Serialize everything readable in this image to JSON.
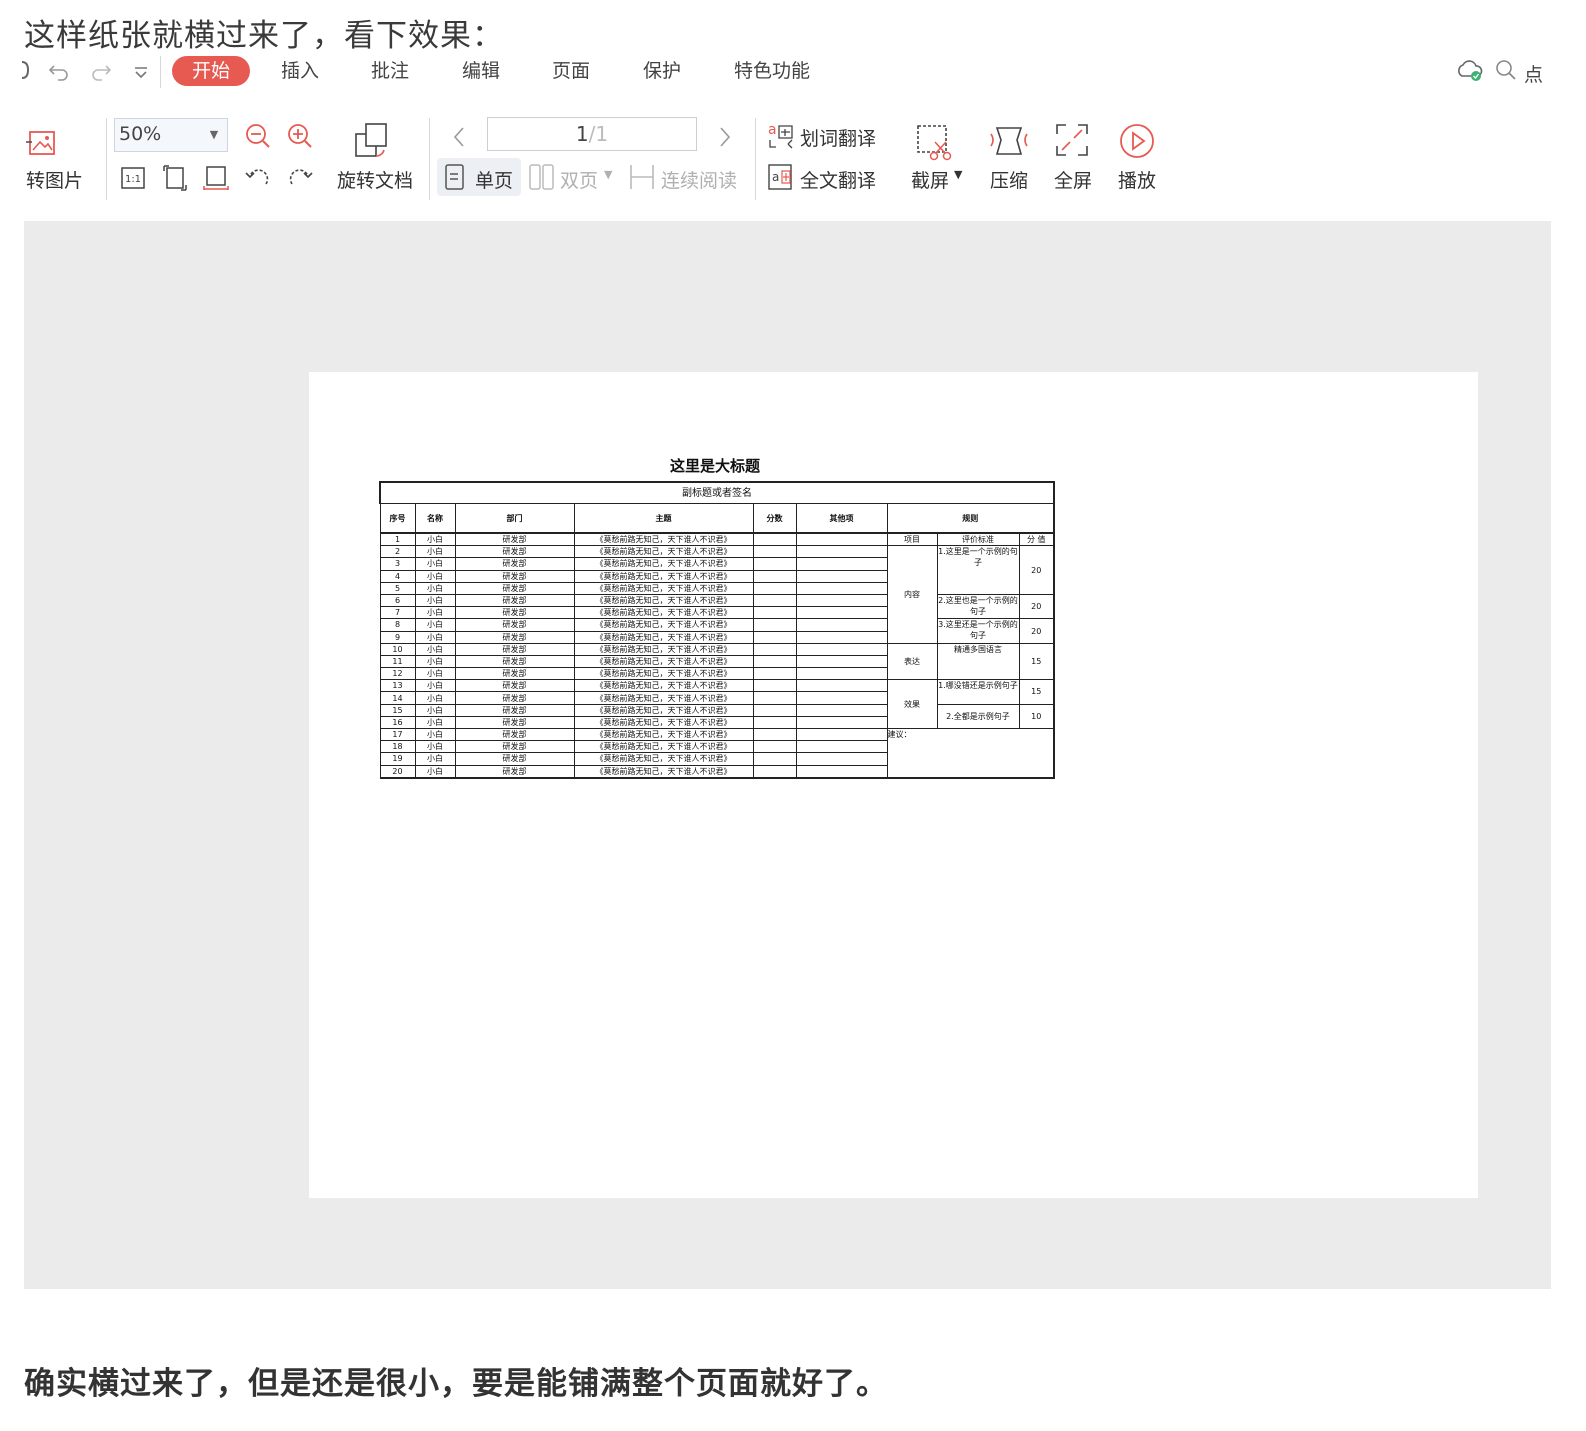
{
  "intro_text": "这样纸张就横过来了，看下效果：",
  "outro_text": "确实横过来了，但是还是很小，要是能铺满整个页面就好了。",
  "ribbon": {
    "tabs": [
      "开始",
      "插入",
      "批注",
      "编辑",
      "页面",
      "保护",
      "特色功能"
    ],
    "active_tab": "开始",
    "right_text": "点"
  },
  "toolbar": {
    "convert_image": "转图片",
    "zoom_value": "50%",
    "rotate_doc": "旋转文档",
    "page_current": "1",
    "page_total": "/1",
    "single_page": "单页",
    "double_page": "双页",
    "continuous": "连续阅读",
    "word_translate": "划词翻译",
    "full_translate": "全文翻译",
    "screenshot": "截屏",
    "compress": "压缩",
    "fullscreen": "全屏",
    "play": "播放",
    "actual_size_label": "1:1"
  },
  "colors": {
    "accent": "#e65a52",
    "viewer_bg": "#ebebeb",
    "play_icon": "#e65a52",
    "cloud_check": "#3cb371"
  },
  "document": {
    "title": "这里是大标题",
    "subtitle": "副标题或者签名",
    "headers": [
      "序号",
      "名称",
      "部门",
      "主题",
      "分数",
      "其他项",
      "规则"
    ],
    "rows": [
      [
        "1",
        "小白",
        "研发部",
        "《莫愁前路无知己，天下谁人不识君》"
      ],
      [
        "2",
        "小白",
        "研发部",
        "《莫愁前路无知己，天下谁人不识君》"
      ],
      [
        "3",
        "小白",
        "研发部",
        "《莫愁前路无知己，天下谁人不识君》"
      ],
      [
        "4",
        "小白",
        "研发部",
        "《莫愁前路无知己，天下谁人不识君》"
      ],
      [
        "5",
        "小白",
        "研发部",
        "《莫愁前路无知己，天下谁人不识君》"
      ],
      [
        "6",
        "小白",
        "研发部",
        "《莫愁前路无知己，天下谁人不识君》"
      ],
      [
        "7",
        "小白",
        "研发部",
        "《莫愁前路无知己，天下谁人不识君》"
      ],
      [
        "8",
        "小白",
        "研发部",
        "《莫愁前路无知己，天下谁人不识君》"
      ],
      [
        "9",
        "小白",
        "研发部",
        "《莫愁前路无知己，天下谁人不识君》"
      ],
      [
        "10",
        "小白",
        "研发部",
        "《莫愁前路无知己，天下谁人不识君》"
      ],
      [
        "11",
        "小白",
        "研发部",
        "《莫愁前路无知己，天下谁人不识君》"
      ],
      [
        "12",
        "小白",
        "研发部",
        "《莫愁前路无知己，天下谁人不识君》"
      ],
      [
        "13",
        "小白",
        "研发部",
        "《莫愁前路无知己，天下谁人不识君》"
      ],
      [
        "14",
        "小白",
        "研发部",
        "《莫愁前路无知己，天下谁人不识君》"
      ],
      [
        "15",
        "小白",
        "研发部",
        "《莫愁前路无知己，天下谁人不识君》"
      ],
      [
        "16",
        "小白",
        "研发部",
        "《莫愁前路无知己，天下谁人不识君》"
      ],
      [
        "17",
        "小白",
        "研发部",
        "《莫愁前路无知己，天下谁人不识君》"
      ],
      [
        "18",
        "小白",
        "研发部",
        "《莫愁前路无知己，天下谁人不识君》"
      ],
      [
        "19",
        "小白",
        "研发部",
        "《莫愁前路无知己，天下谁人不识君》"
      ],
      [
        "20",
        "小白",
        "研发部",
        "《莫愁前路无知己，天下谁人不识君》"
      ]
    ],
    "rules": {
      "col_item": "项目",
      "col_standard": "评价标准",
      "col_score": "分 值",
      "content_label": "内容",
      "content_1": "1.这里是一个示例的句子",
      "content_1_score": "20",
      "content_2": "2.这里也是一个示例的句子",
      "content_2_score": "20",
      "content_3": "3.这里还是一个示例的句子",
      "content_3_score": "20",
      "express_label": "表达",
      "express_1": "精通多国语言",
      "express_1_score": "15",
      "effect_label": "效果",
      "effect_1": "1.哪没错还是示例句子",
      "effect_1_score": "15",
      "effect_2": "2.全都是示例句子",
      "effect_2_score": "10",
      "suggestion": "建议："
    }
  }
}
